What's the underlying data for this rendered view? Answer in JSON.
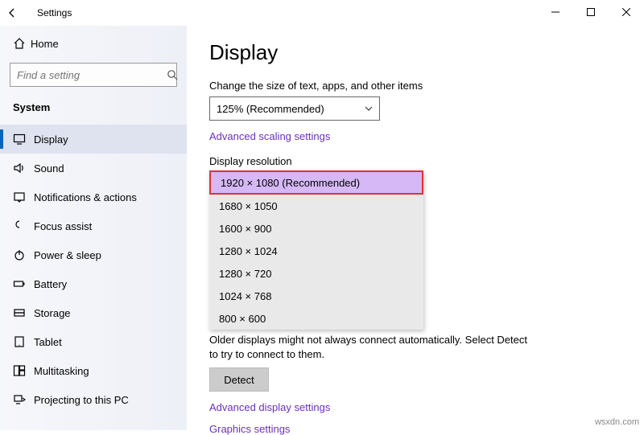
{
  "window": {
    "title": "Settings"
  },
  "sidebar": {
    "home": "Home",
    "search_placeholder": "Find a setting",
    "group": "System",
    "items": [
      {
        "icon": "display",
        "label": "Display",
        "selected": true
      },
      {
        "icon": "sound",
        "label": "Sound"
      },
      {
        "icon": "notifications",
        "label": "Notifications & actions"
      },
      {
        "icon": "focus",
        "label": "Focus assist"
      },
      {
        "icon": "power",
        "label": "Power & sleep"
      },
      {
        "icon": "battery",
        "label": "Battery"
      },
      {
        "icon": "storage",
        "label": "Storage"
      },
      {
        "icon": "tablet",
        "label": "Tablet"
      },
      {
        "icon": "multitask",
        "label": "Multitasking"
      },
      {
        "icon": "project",
        "label": "Projecting to this PC"
      }
    ]
  },
  "main": {
    "title": "Display",
    "scale_label": "Change the size of text, apps, and other items",
    "scale_value": "125% (Recommended)",
    "adv_scaling": "Advanced scaling settings",
    "res_label": "Display resolution",
    "res_options": [
      {
        "label": "1920 × 1080 (Recommended)",
        "selected": true
      },
      {
        "label": "1680 × 1050"
      },
      {
        "label": "1600 × 900"
      },
      {
        "label": "1280 × 1024"
      },
      {
        "label": "1280 × 720"
      },
      {
        "label": "1024 × 768"
      },
      {
        "label": "800 × 600"
      }
    ],
    "older_note": "Older displays might not always connect automatically. Select Detect to try to connect to them.",
    "detect": "Detect",
    "adv_display": "Advanced display settings",
    "graphics": "Graphics settings"
  },
  "watermark": "wsxdn.com"
}
